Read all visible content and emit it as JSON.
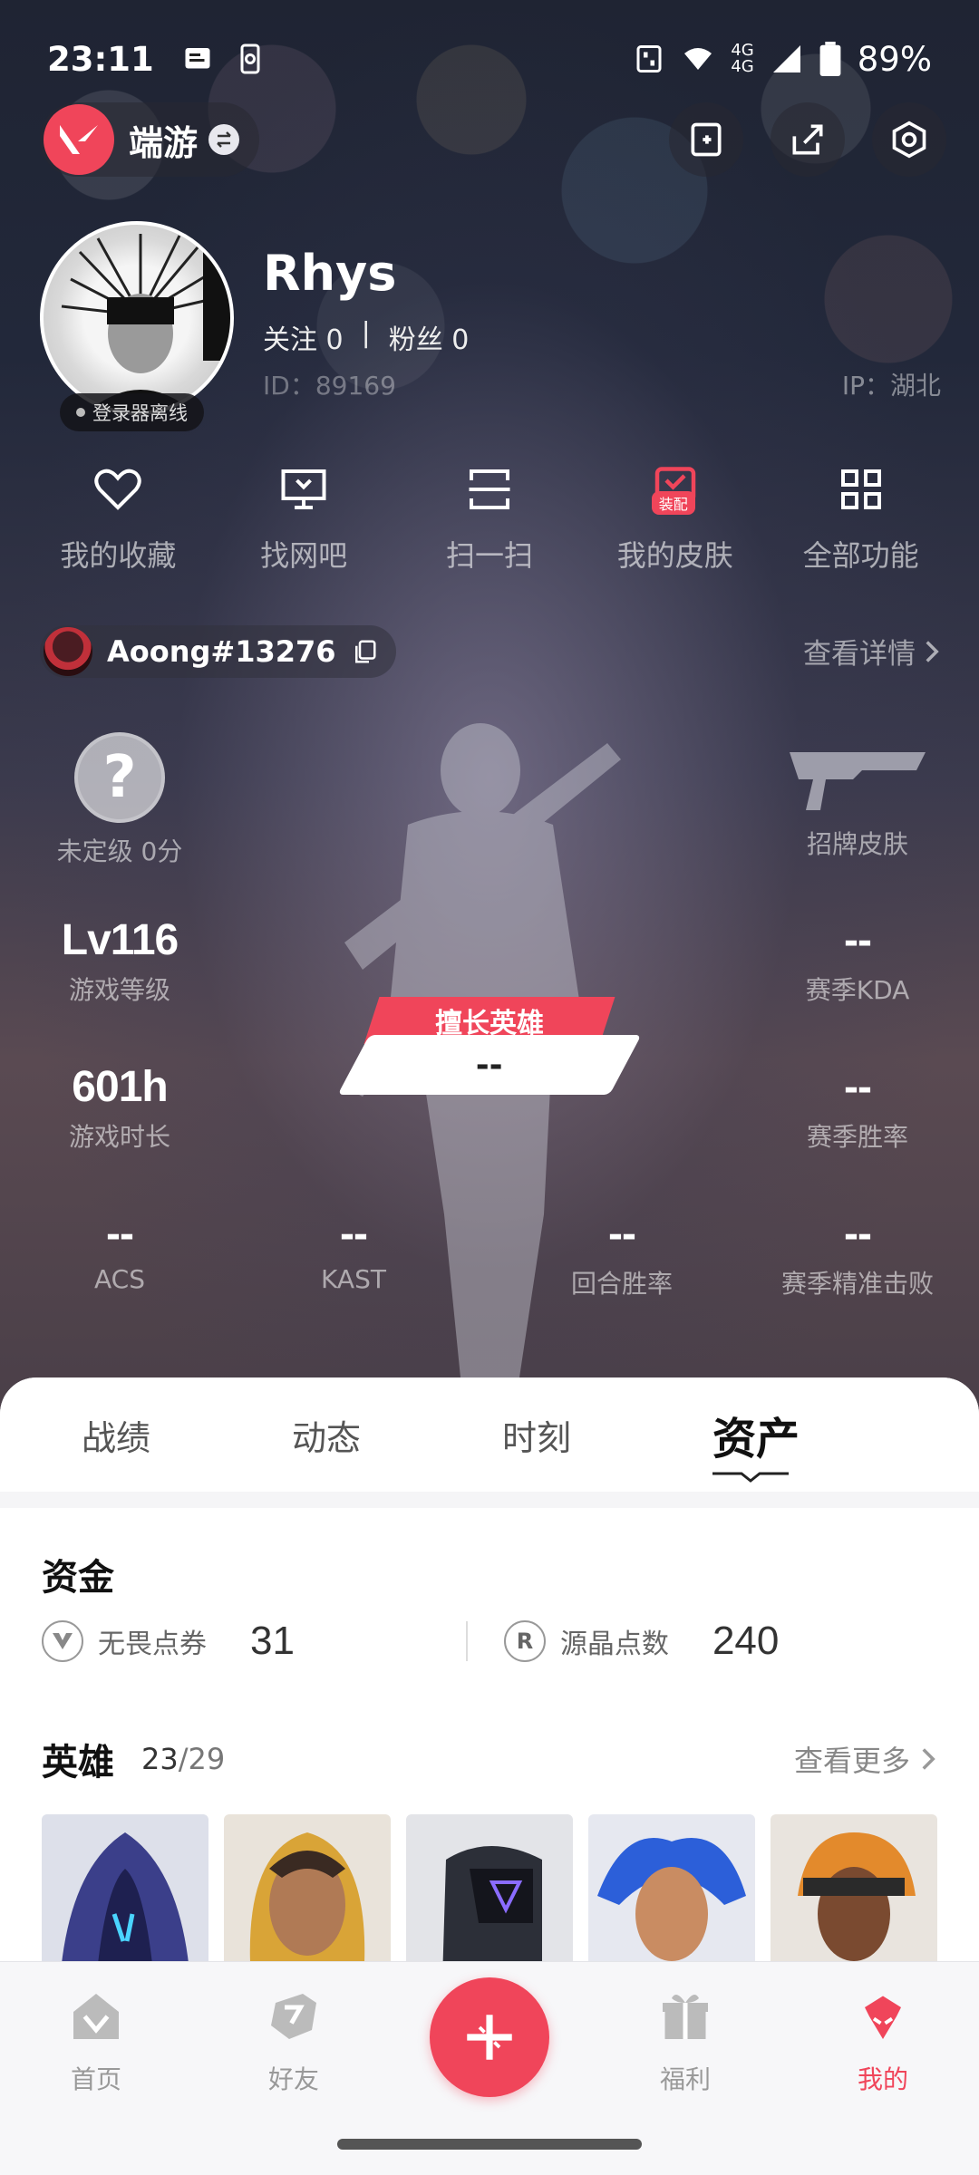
{
  "status_bar": {
    "time": "23:11",
    "network_1": "4G",
    "network_2": "4G",
    "battery": "89%"
  },
  "topbar": {
    "brand_name": "端游"
  },
  "profile": {
    "username": "Rhys",
    "follow_label": "关注",
    "follow_count": "0",
    "fans_label": "粉丝",
    "fans_count": "0",
    "separator": "|",
    "id_text": "ID：89169",
    "ip_text": "IP：湖北",
    "status_text": "登录器离线"
  },
  "quick_actions": [
    {
      "label": "我的收藏",
      "icon": "heart-icon"
    },
    {
      "label": "找网吧",
      "icon": "monitor-icon"
    },
    {
      "label": "扫一扫",
      "icon": "scan-icon"
    },
    {
      "label": "我的皮肤",
      "icon": "skin-icon",
      "badge": "装配"
    },
    {
      "label": "全部功能",
      "icon": "grid-icon"
    }
  ],
  "account": {
    "riot_id": "Aoong#13276",
    "details_link": "查看详情"
  },
  "stats": {
    "rank_value": "?",
    "rank_label": "未定级 0分",
    "skin_label": "招牌皮肤",
    "level_value": "Lv116",
    "level_label": "游戏等级",
    "kda_value": "--",
    "kda_label": "赛季KDA",
    "hours_value": "601h",
    "hours_label": "游戏时长",
    "winrate_value": "--",
    "winrate_label": "赛季胜率",
    "hero_tag": "擅长英雄",
    "hero_value": "--",
    "acs_value": "--",
    "acs_label": "ACS",
    "kast_value": "--",
    "kast_label": "KAST",
    "round_value": "--",
    "round_label": "回合胜率",
    "headshot_value": "--",
    "headshot_label": "赛季精准击败"
  },
  "tabs": [
    {
      "label": "战绩"
    },
    {
      "label": "动态"
    },
    {
      "label": "时刻"
    },
    {
      "label": "资产"
    }
  ],
  "active_tab": "资产",
  "funds": {
    "title": "资金",
    "vp_label": "无畏点券",
    "vp_value": "31",
    "rp_label": "源晶点数",
    "rp_value": "240"
  },
  "heroes": {
    "title": "英雄",
    "owned": "23",
    "slash": "/",
    "total": "29",
    "more_link": "查看更多"
  },
  "bottom_nav": [
    {
      "label": "首页",
      "icon": "home-icon"
    },
    {
      "label": "好友",
      "icon": "friends-icon"
    },
    {
      "label": "福利",
      "icon": "gift-icon"
    },
    {
      "label": "我的",
      "icon": "profile-icon",
      "active": true
    }
  ],
  "colors": {
    "accent": "#f0455a"
  }
}
